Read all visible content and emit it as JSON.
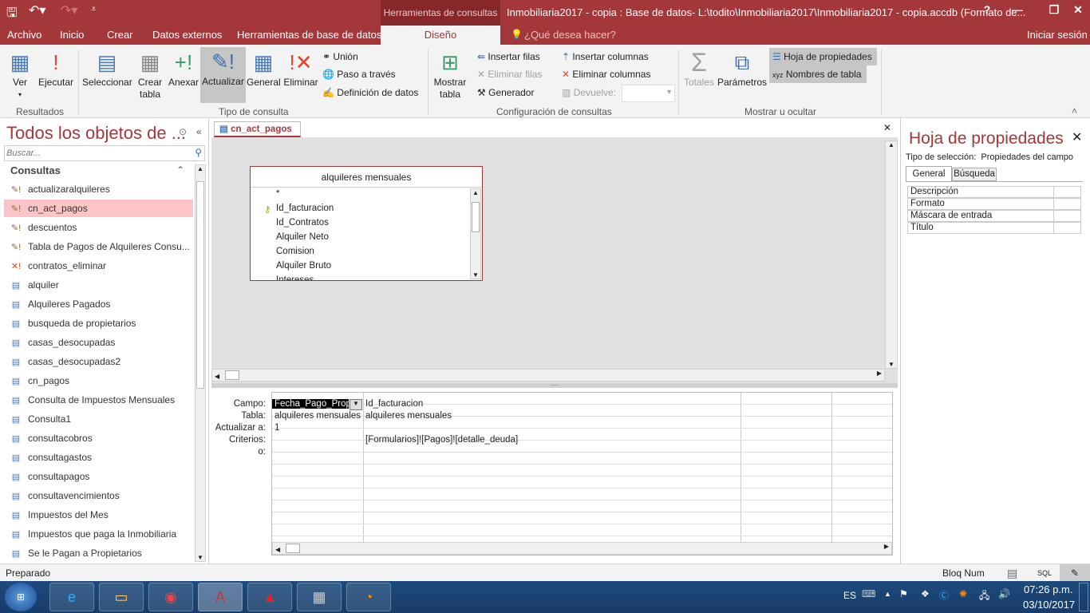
{
  "titlebar": {
    "contextual_tab": "Herramientas de consultas",
    "title": "Inmobiliaria2017 - copia : Base de datos- L:\\todito\\Inmobiliaria2017\\Inmobiliaria2017 - copia.accdb (Formato de...",
    "help": "?",
    "minimize": "—",
    "restore": "❐",
    "close": "✕"
  },
  "tabs": [
    "Archivo",
    "Inicio",
    "Crear",
    "Datos externos",
    "Herramientas de base de datos",
    "Diseño"
  ],
  "tellme": "¿Qué desea hacer?",
  "signin": "Iniciar sesión",
  "ribbon": {
    "resultados": {
      "label": "Resultados",
      "ver": "Ver",
      "ejecutar": "Ejecutar"
    },
    "tipo": {
      "label": "Tipo de consulta",
      "seleccionar": "Seleccionar",
      "crear_tabla": "Crear tabla",
      "anexar": "Anexar",
      "actualizar": "Actualizar",
      "general": "General",
      "eliminar": "Eliminar",
      "union": "Unión",
      "paso": "Paso a través",
      "definicion": "Definición de datos"
    },
    "config": {
      "label": "Configuración de consultas",
      "mostrar_tabla": "Mostrar tabla",
      "insertar_filas": "Insertar filas",
      "eliminar_filas": "Eliminar filas",
      "generador": "Generador",
      "insertar_columnas": "Insertar columnas",
      "eliminar_columnas": "Eliminar columnas",
      "devuelve": "Devuelve:",
      "devuelve_value": ""
    },
    "mostrar": {
      "label": "Mostrar u ocultar",
      "totales": "Totales",
      "parametros": "Parámetros",
      "hoja": "Hoja de propiedades",
      "nombres": "Nombres de tabla"
    }
  },
  "nav": {
    "title": "Todos los objetos de ...",
    "search_placeholder": "Buscar...",
    "section": "Consultas",
    "items": [
      {
        "label": "actualizaralquileres",
        "icon": "update-query-icon"
      },
      {
        "label": "cn_act_pagos",
        "icon": "update-query-icon",
        "selected": true
      },
      {
        "label": "descuentos",
        "icon": "update-query-icon"
      },
      {
        "label": "Tabla de Pagos de Alquileres Consu...",
        "icon": "update-query-icon"
      },
      {
        "label": "contratos_eliminar",
        "icon": "delete-query-icon"
      },
      {
        "label": "alquiler",
        "icon": "select-query-icon"
      },
      {
        "label": "Alquileres Pagados",
        "icon": "select-query-icon"
      },
      {
        "label": "busqueda de propietarios",
        "icon": "select-query-icon"
      },
      {
        "label": "casas_desocupadas",
        "icon": "select-query-icon"
      },
      {
        "label": "casas_desocupadas2",
        "icon": "select-query-icon"
      },
      {
        "label": "cn_pagos",
        "icon": "select-query-icon"
      },
      {
        "label": "Consulta de Impuestos Mensuales",
        "icon": "select-query-icon"
      },
      {
        "label": "Consulta1",
        "icon": "select-query-icon"
      },
      {
        "label": "consultacobros",
        "icon": "select-query-icon"
      },
      {
        "label": "consultagastos",
        "icon": "select-query-icon"
      },
      {
        "label": "consultapagos",
        "icon": "select-query-icon"
      },
      {
        "label": "consultavencimientos",
        "icon": "select-query-icon"
      },
      {
        "label": "Impuestos del Mes",
        "icon": "select-query-icon"
      },
      {
        "label": "Impuestos que paga la Inmobiliaria",
        "icon": "select-query-icon"
      },
      {
        "label": "Se le Pagan a Propietarios",
        "icon": "select-query-icon"
      }
    ]
  },
  "doc": {
    "tab": "cn_act_pagos",
    "table": {
      "name": "alquileres mensuales",
      "fields": [
        "*",
        "Id_facturacion",
        "Id_Contratos",
        "Alquiler Neto",
        "Comision",
        "Alquiler Bruto",
        "Intereses"
      ]
    },
    "grid": {
      "row_labels": [
        "Campo:",
        "Tabla:",
        "Actualizar a:",
        "Criterios:",
        "o:"
      ],
      "columns": [
        {
          "campo": "Fecha_Pago_Propi",
          "tabla": "alquileres mensuales",
          "actualizar": "1",
          "criterios": ""
        },
        {
          "campo": "Id_facturacion",
          "tabla": "alquileres mensuales",
          "actualizar": "",
          "criterios": "[Formularios]![Pagos]![detalle_deuda]"
        }
      ]
    }
  },
  "props": {
    "title": "Hoja de propiedades",
    "sel_label": "Tipo de selección:",
    "sel_value": "Propiedades del campo",
    "tabs": [
      "General",
      "Búsqueda"
    ],
    "rows": [
      "Descripción",
      "Formato",
      "Máscara de entrada",
      "Título"
    ]
  },
  "status": {
    "left": "Preparado",
    "bloq": "Bloq Num",
    "sql": "SQL"
  },
  "taskbar": {
    "lang": "ES",
    "time": "07:26 p.m.",
    "date": "03/10/2017"
  },
  "colors": {
    "accent": "#a4373a",
    "selected": "#fcc4c6"
  }
}
